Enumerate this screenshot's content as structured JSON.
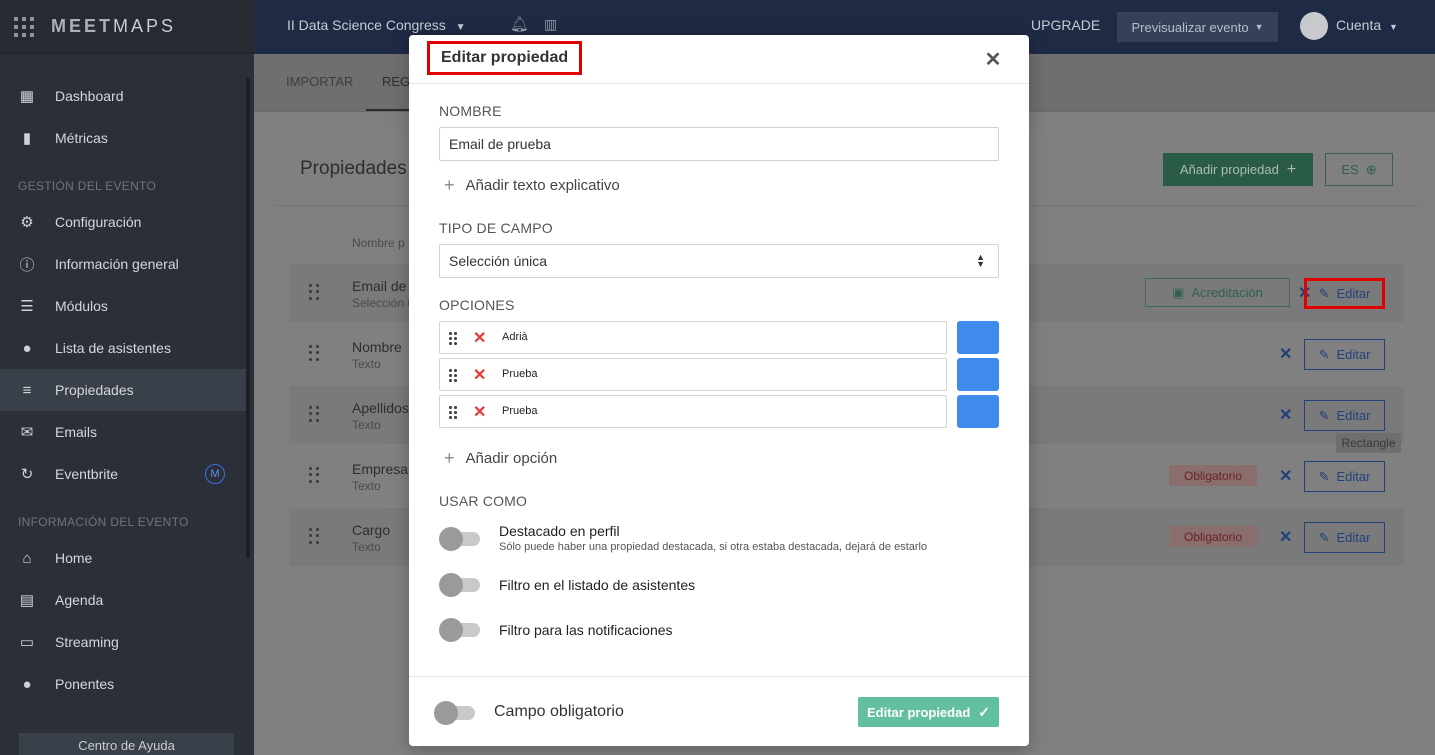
{
  "sidebar": {
    "brand_bold": "MEET",
    "brand_rest": "MAPS",
    "items_top": [
      {
        "label": "Dashboard",
        "icon": "dashboard-icon"
      },
      {
        "label": "Métricas",
        "icon": "bar-chart-icon"
      }
    ],
    "section_event": "GESTIÓN DEL EVENTO",
    "items_event": [
      {
        "label": "Configuración",
        "icon": "gear-icon"
      },
      {
        "label": "Información general",
        "icon": "info-icon"
      },
      {
        "label": "Módulos",
        "icon": "menu-icon"
      },
      {
        "label": "Lista de asistentes",
        "icon": "users-icon"
      },
      {
        "label": "Propiedades",
        "icon": "list-icon"
      },
      {
        "label": "Emails",
        "icon": "envelope-icon"
      },
      {
        "label": "Eventbrite",
        "icon": "refresh-icon",
        "badge": "M"
      }
    ],
    "section_info": "INFORMACIÓN DEL EVENTO",
    "items_info": [
      {
        "label": "Home",
        "icon": "home-icon"
      },
      {
        "label": "Agenda",
        "icon": "calendar-icon"
      },
      {
        "label": "Streaming",
        "icon": "cast-icon"
      },
      {
        "label": "Ponentes",
        "icon": "microphone-icon"
      }
    ],
    "help": "Centro de Ayuda"
  },
  "topbar": {
    "event_name": "II Data Science Congress",
    "upgrade": "UPGRADE",
    "preview": "Previsualizar evento",
    "account": "Cuenta"
  },
  "tabs": [
    "IMPORTAR",
    "REGI"
  ],
  "page": {
    "title": "Propiedades",
    "add_button": "Añadir propiedad",
    "lang_button": "ES",
    "column_header": "Nombre p",
    "rows": [
      {
        "name": "Email de",
        "type": "Selección ú",
        "accreditation": "Acreditación",
        "edit": "Editar"
      },
      {
        "name": "Nombre",
        "type": "Texto",
        "edit": "Editar"
      },
      {
        "name": "Apellidos",
        "type": "Texto",
        "edit": "Editar"
      },
      {
        "name": "Empresa",
        "type": "Texto",
        "badge": "Obligatorio",
        "edit": "Editar"
      },
      {
        "name": "Cargo",
        "type": "Texto",
        "badge": "Obligatorio",
        "edit": "Editar"
      }
    ],
    "tooltip": "Rectangle"
  },
  "modal": {
    "title": "Editar propiedad",
    "name_label": "NOMBRE",
    "name_value": "Email de prueba",
    "add_help_text": "Añadir texto explicativo",
    "field_type_label": "TIPO DE CAMPO",
    "field_type_value": "Selección única",
    "options_label": "OPCIONES",
    "options": [
      {
        "text": "Adrià",
        "color": "#3e8aed"
      },
      {
        "text": "Prueba",
        "color": "#3e8aed"
      },
      {
        "text": "Prueba",
        "color": "#3e8aed"
      }
    ],
    "add_option": "Añadir opción",
    "use_as_label": "USAR COMO",
    "toggles": [
      {
        "title": "Destacado en perfil",
        "subtitle": "Sólo puede haber una propiedad destacada, si otra estaba destacada, dejará de estarlo",
        "on": false
      },
      {
        "title": "Filtro en el listado de asistentes",
        "on": false
      },
      {
        "title": "Filtro para las notificaciones",
        "on": false
      }
    ],
    "required_label": "Campo obligatorio",
    "required_on": false,
    "save_button": "Editar propiedad"
  },
  "colors": {
    "highlight": "#e00000",
    "save_button": "#62c0a0",
    "option_swatch": "#3e8aed",
    "delete_x": "#e53935"
  }
}
